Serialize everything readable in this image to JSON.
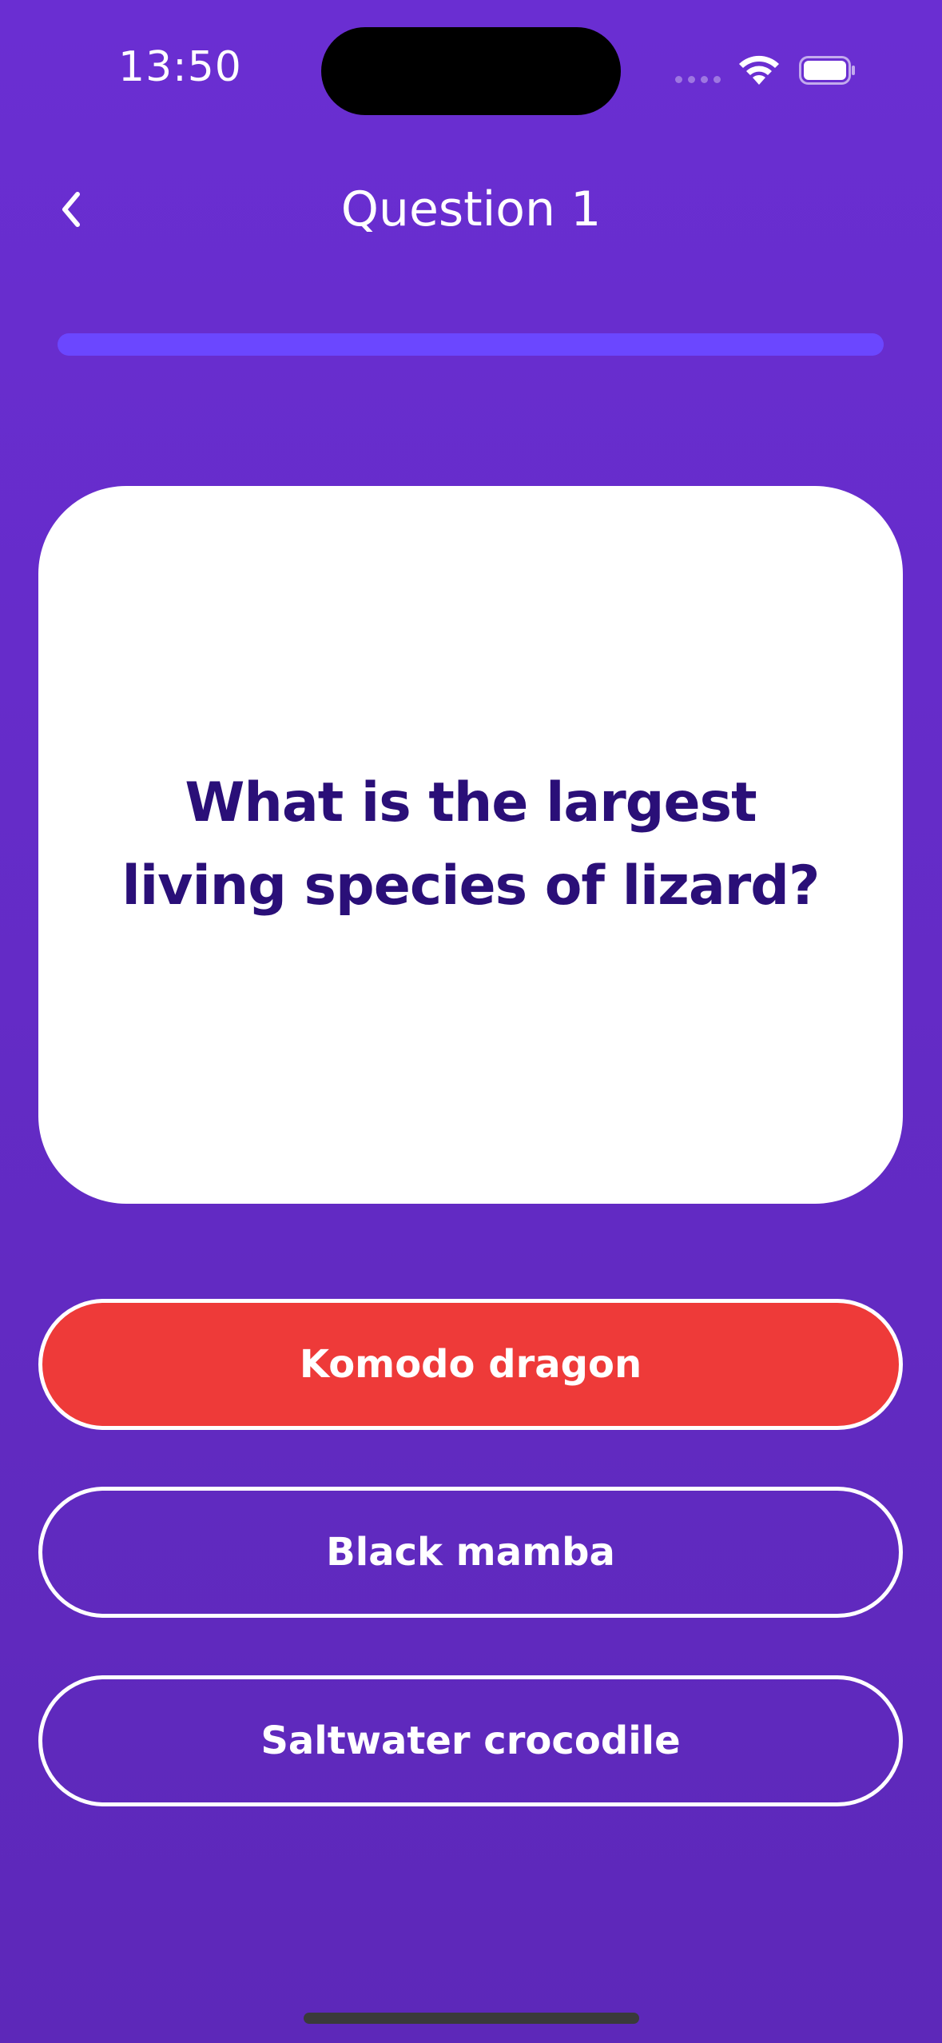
{
  "status_bar": {
    "time": "13:50"
  },
  "header": {
    "title": "Question 1",
    "back_icon": "chevron-left-icon"
  },
  "progress": {
    "fraction": 1.0
  },
  "question": {
    "text": "What is the largest living species of lizard?"
  },
  "answers": [
    {
      "label": "Komodo dragon",
      "selected": true
    },
    {
      "label": "Black mamba",
      "selected": false
    },
    {
      "label": "Saltwater crocodile",
      "selected": false
    }
  ],
  "colors": {
    "background_top": "#6A2ED2",
    "background_bottom": "#5D28B9",
    "question_text": "#2A0F78",
    "selected_answer": "#EE3A39",
    "progress": "#6B47FF"
  }
}
